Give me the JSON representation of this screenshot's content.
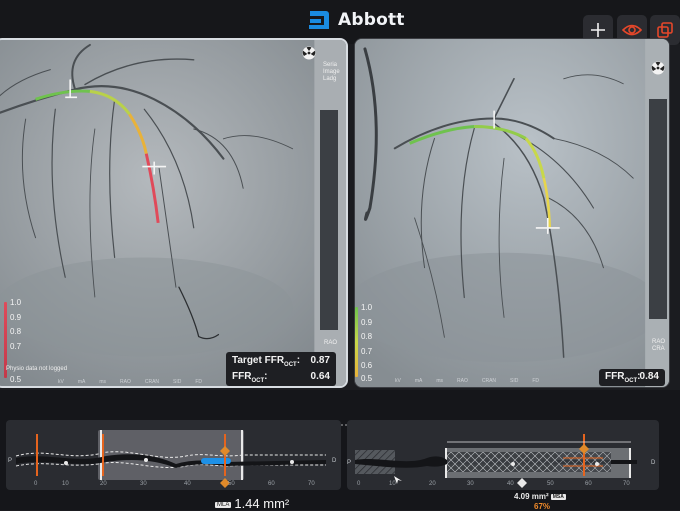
{
  "header": {
    "brand_name": "Abbott",
    "icons": [
      "add-icon",
      "eye-icon",
      "layers-icon"
    ],
    "colors": {
      "accent": "#e5472a",
      "brand_blue": "#1a8be0"
    }
  },
  "left_view": {
    "scale": [
      "1.0",
      "0.9",
      "0.8",
      "0.7",
      "0.6",
      "0.5"
    ],
    "physio_note": "Physio data not logged",
    "strip_labels": [
      "kV",
      "mA",
      "ms",
      "RAO",
      "CRAN",
      "SID",
      "FD"
    ],
    "side_text": "Seria Image Ladg",
    "side_bottom": "RAO",
    "target_label": "Target FFR",
    "target_sub": "OCT",
    "target_value": "0.87",
    "ffr_label": "FFR",
    "ffr_sub": "OCT",
    "ffr_value": "0.64"
  },
  "right_view": {
    "scale": [
      "1.0",
      "0.9",
      "0.8",
      "0.7",
      "0.6",
      "0.5"
    ],
    "strip_labels": [
      "kV",
      "mA",
      "ms",
      "RAO",
      "CRAN",
      "SID",
      "FD"
    ],
    "side_text": "Seria Image Ladg",
    "side_bottom": "RAO CRA",
    "ffr_label": "FFR",
    "ffr_sub": "OCT",
    "ffr_value": "0.84"
  },
  "pullback_left": {
    "proximal": "P",
    "distal": "D",
    "ticks": [
      "0",
      "10",
      "20",
      "30",
      "40",
      "50",
      "60",
      "70"
    ],
    "mla_tag": "MLA",
    "mla_value": "1.44 mm²"
  },
  "pullback_right": {
    "proximal": "P",
    "distal": "D",
    "ticks": [
      "0",
      "10",
      "20",
      "30",
      "40",
      "50",
      "60",
      "70"
    ],
    "msa_value": "4.09 mm²",
    "msa_tag": "MSA",
    "pct_value": "67%"
  }
}
